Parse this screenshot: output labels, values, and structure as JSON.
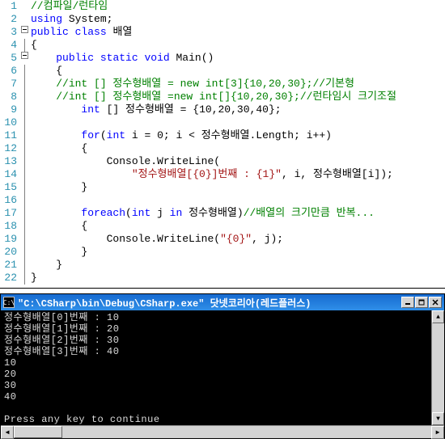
{
  "lines": [
    {
      "n": 1,
      "fold": false,
      "bar": false,
      "segs": [
        {
          "cls": "c-comment",
          "t": "//컴파일/런타임"
        }
      ]
    },
    {
      "n": 2,
      "fold": false,
      "bar": false,
      "segs": [
        {
          "cls": "c-keyword",
          "t": "using"
        },
        {
          "cls": "c-punct",
          "t": " "
        },
        {
          "cls": "c-ident",
          "t": "System"
        },
        {
          "cls": "c-punct",
          "t": ";"
        }
      ]
    },
    {
      "n": 3,
      "fold": true,
      "bar": false,
      "segs": [
        {
          "cls": "c-keyword",
          "t": "public"
        },
        {
          "cls": "c-punct",
          "t": " "
        },
        {
          "cls": "c-keyword",
          "t": "class"
        },
        {
          "cls": "c-punct",
          "t": " "
        },
        {
          "cls": "c-ident",
          "t": "배열"
        }
      ]
    },
    {
      "n": 4,
      "fold": false,
      "bar": true,
      "segs": [
        {
          "cls": "c-punct",
          "t": "{"
        }
      ]
    },
    {
      "n": 5,
      "fold": true,
      "bar": false,
      "segs": [
        {
          "cls": "c-punct",
          "t": "    "
        },
        {
          "cls": "c-keyword",
          "t": "public"
        },
        {
          "cls": "c-punct",
          "t": " "
        },
        {
          "cls": "c-keyword",
          "t": "static"
        },
        {
          "cls": "c-punct",
          "t": " "
        },
        {
          "cls": "c-keyword",
          "t": "void"
        },
        {
          "cls": "c-punct",
          "t": " "
        },
        {
          "cls": "c-ident",
          "t": "Main()"
        }
      ]
    },
    {
      "n": 6,
      "fold": false,
      "bar": true,
      "segs": [
        {
          "cls": "c-punct",
          "t": "    {"
        }
      ]
    },
    {
      "n": 7,
      "fold": false,
      "bar": true,
      "segs": [
        {
          "cls": "c-punct",
          "t": "    "
        },
        {
          "cls": "c-comment",
          "t": "//int [] 정수형배열 = new int[3]{10,20,30};//기본형"
        }
      ]
    },
    {
      "n": 8,
      "fold": false,
      "bar": true,
      "segs": [
        {
          "cls": "c-punct",
          "t": "    "
        },
        {
          "cls": "c-comment",
          "t": "//int [] 정수형배열 =new int[]{10,20,30};//런타임시 크기조절"
        }
      ]
    },
    {
      "n": 9,
      "fold": false,
      "bar": true,
      "segs": [
        {
          "cls": "c-punct",
          "t": "        "
        },
        {
          "cls": "c-keyword",
          "t": "int"
        },
        {
          "cls": "c-punct",
          "t": " [] "
        },
        {
          "cls": "c-ident",
          "t": "정수형배열"
        },
        {
          "cls": "c-punct",
          "t": " = {"
        },
        {
          "cls": "c-num",
          "t": "10"
        },
        {
          "cls": "c-punct",
          "t": ","
        },
        {
          "cls": "c-num",
          "t": "20"
        },
        {
          "cls": "c-punct",
          "t": ","
        },
        {
          "cls": "c-num",
          "t": "30"
        },
        {
          "cls": "c-punct",
          "t": ","
        },
        {
          "cls": "c-num",
          "t": "40"
        },
        {
          "cls": "c-punct",
          "t": "};"
        }
      ]
    },
    {
      "n": 10,
      "fold": false,
      "bar": true,
      "segs": []
    },
    {
      "n": 11,
      "fold": false,
      "bar": true,
      "segs": [
        {
          "cls": "c-punct",
          "t": "        "
        },
        {
          "cls": "c-keyword",
          "t": "for"
        },
        {
          "cls": "c-punct",
          "t": "("
        },
        {
          "cls": "c-keyword",
          "t": "int"
        },
        {
          "cls": "c-punct",
          "t": " i = "
        },
        {
          "cls": "c-num",
          "t": "0"
        },
        {
          "cls": "c-punct",
          "t": "; i < "
        },
        {
          "cls": "c-ident",
          "t": "정수형배열"
        },
        {
          "cls": "c-punct",
          "t": ".Length; i++)"
        }
      ]
    },
    {
      "n": 12,
      "fold": false,
      "bar": true,
      "segs": [
        {
          "cls": "c-punct",
          "t": "        {"
        }
      ]
    },
    {
      "n": 13,
      "fold": false,
      "bar": true,
      "segs": [
        {
          "cls": "c-punct",
          "t": "            "
        },
        {
          "cls": "c-ident",
          "t": "Console"
        },
        {
          "cls": "c-punct",
          "t": ".WriteLine("
        }
      ]
    },
    {
      "n": 14,
      "fold": false,
      "bar": true,
      "segs": [
        {
          "cls": "c-punct",
          "t": "                "
        },
        {
          "cls": "c-string",
          "t": "\"정수형배열[{0}]번째 : {1}\""
        },
        {
          "cls": "c-punct",
          "t": ", i, "
        },
        {
          "cls": "c-ident",
          "t": "정수형배열"
        },
        {
          "cls": "c-punct",
          "t": "[i]);"
        }
      ]
    },
    {
      "n": 15,
      "fold": false,
      "bar": true,
      "segs": [
        {
          "cls": "c-punct",
          "t": "        }"
        }
      ]
    },
    {
      "n": 16,
      "fold": false,
      "bar": true,
      "segs": []
    },
    {
      "n": 17,
      "fold": false,
      "bar": true,
      "segs": [
        {
          "cls": "c-punct",
          "t": "        "
        },
        {
          "cls": "c-keyword",
          "t": "foreach"
        },
        {
          "cls": "c-punct",
          "t": "("
        },
        {
          "cls": "c-keyword",
          "t": "int"
        },
        {
          "cls": "c-punct",
          "t": " j "
        },
        {
          "cls": "c-keyword",
          "t": "in"
        },
        {
          "cls": "c-punct",
          "t": " "
        },
        {
          "cls": "c-ident",
          "t": "정수형배열"
        },
        {
          "cls": "c-punct",
          "t": ")"
        },
        {
          "cls": "c-comment",
          "t": "//배열의 크기만큼 반복..."
        }
      ]
    },
    {
      "n": 18,
      "fold": false,
      "bar": true,
      "segs": [
        {
          "cls": "c-punct",
          "t": "        {"
        }
      ]
    },
    {
      "n": 19,
      "fold": false,
      "bar": true,
      "segs": [
        {
          "cls": "c-punct",
          "t": "            "
        },
        {
          "cls": "c-ident",
          "t": "Console"
        },
        {
          "cls": "c-punct",
          "t": ".WriteLine("
        },
        {
          "cls": "c-string",
          "t": "\"{0}\""
        },
        {
          "cls": "c-punct",
          "t": ", j);"
        }
      ]
    },
    {
      "n": 20,
      "fold": false,
      "bar": true,
      "segs": [
        {
          "cls": "c-punct",
          "t": "        }"
        }
      ]
    },
    {
      "n": 21,
      "fold": false,
      "bar": true,
      "segs": [
        {
          "cls": "c-punct",
          "t": "    }"
        }
      ]
    },
    {
      "n": 22,
      "fold": false,
      "bar": true,
      "segs": [
        {
          "cls": "c-punct",
          "t": "}"
        }
      ]
    }
  ],
  "console": {
    "icon_text": "C:\\",
    "title": "\"C:\\CSharp\\bin\\Debug\\CSharp.exe\" 닷넷코리아(레드플러스)",
    "lines": [
      "정수형배열[0]번째 : 10",
      "정수형배열[1]번째 : 20",
      "정수형배열[2]번째 : 30",
      "정수형배열[3]번째 : 40",
      "10",
      "20",
      "30",
      "40",
      "",
      "Press any key to continue"
    ]
  }
}
